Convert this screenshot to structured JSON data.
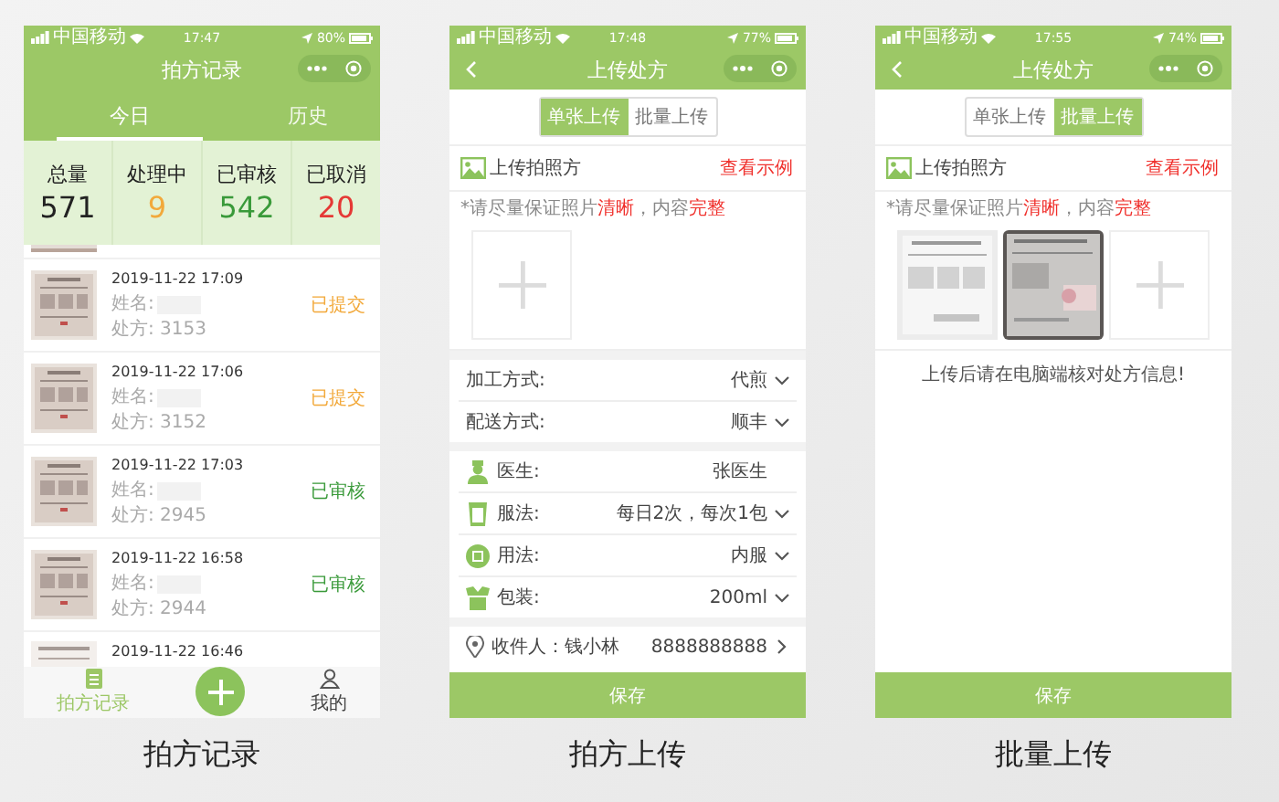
{
  "phones": [
    {
      "kind": "records",
      "caption": "拍方记录",
      "status_bar": {
        "carrier": "中国移动",
        "time": "17:47",
        "battery": "80%"
      },
      "title": "拍方记录",
      "tabs": [
        {
          "label": "今日",
          "selected": true
        },
        {
          "label": "历史",
          "selected": false
        }
      ],
      "stats": [
        {
          "label": "总量",
          "value": "571",
          "color": "#222222"
        },
        {
          "label": "处理中",
          "value": "9",
          "color": "#f2a93b"
        },
        {
          "label": "已审核",
          "value": "542",
          "color": "#3a9a3a"
        },
        {
          "label": "已取消",
          "value": "20",
          "color": "#e53935"
        }
      ],
      "records": [
        {
          "date": "2019-11-22 17:09",
          "name_label": "姓名:",
          "rx": "处方: 3153",
          "status": "已提交",
          "color": "#f2a93b"
        },
        {
          "date": "2019-11-22 17:06",
          "name_label": "姓名:",
          "rx": "处方: 3152",
          "status": "已提交",
          "color": "#f2a93b"
        },
        {
          "date": "2019-11-22 17:03",
          "name_label": "姓名:",
          "rx": "处方: 2945",
          "status": "已审核",
          "color": "#3a9a3a"
        },
        {
          "date": "2019-11-22 16:58",
          "name_label": "姓名:",
          "rx": "处方: 2944",
          "status": "已审核",
          "color": "#3a9a3a"
        }
      ],
      "partial_record": {
        "date": "2019-11-22 16:46"
      },
      "nav": [
        {
          "label": "拍方记录",
          "selected": true
        },
        {
          "label": "我的",
          "selected": false
        }
      ]
    },
    {
      "kind": "single_upload",
      "caption": "拍方上传",
      "status_bar": {
        "carrier": "中国移动",
        "time": "17:48",
        "battery": "77%"
      },
      "title": "上传处方",
      "segments": [
        {
          "label": "单张上传",
          "selected": true
        },
        {
          "label": "批量上传",
          "selected": false
        }
      ],
      "upload_label": "上传拍照方",
      "example_link": "查看示例",
      "hint": "*请尽量保证照片**清晰**，内容**完整**",
      "groups": [
        {
          "kind": "plain",
          "rows": [
            {
              "label": "加工方式:",
              "value": "代煎",
              "dropdown": true
            },
            {
              "label": "配送方式:",
              "value": "顺丰",
              "dropdown": true
            }
          ]
        },
        {
          "kind": "icon",
          "rows": [
            {
              "label": "医生:",
              "value": "张医生",
              "dropdown": false
            },
            {
              "label": "服法:",
              "value": "每日2次，每次1包",
              "dropdown": true
            },
            {
              "label": "用法:",
              "value": "内服",
              "dropdown": true
            },
            {
              "label": "包装:",
              "value": "200ml",
              "dropdown": true
            }
          ]
        }
      ],
      "recipient": {
        "name": "收件人：钱小林",
        "phone": "8888888888"
      },
      "save": "保存"
    },
    {
      "kind": "batch_upload",
      "caption": "批量上传",
      "status_bar": {
        "carrier": "中国移动",
        "time": "17:55",
        "battery": "74%"
      },
      "title": "上传处方",
      "segments": [
        {
          "label": "单张上传",
          "selected": false
        },
        {
          "label": "批量上传",
          "selected": true
        }
      ],
      "upload_label": "上传拍照方",
      "example_link": "查看示例",
      "hint": "*请尽量保证照片**清晰**，内容**完整**",
      "note": "上传后请在电脑端核对处方信息!",
      "save": "保存"
    }
  ]
}
